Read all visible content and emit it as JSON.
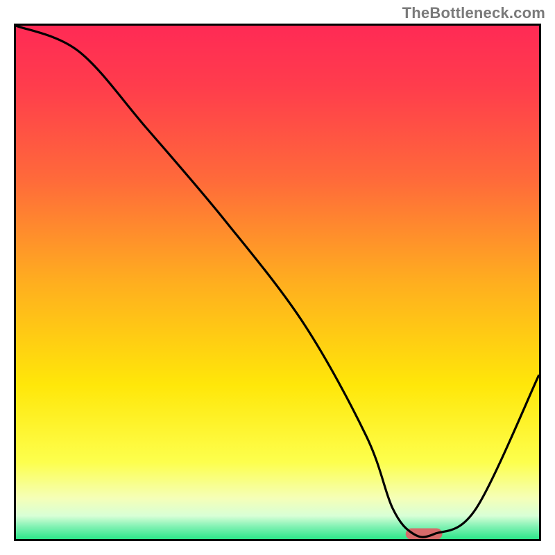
{
  "watermark": "TheBottleneck.com",
  "chart_data": {
    "type": "line",
    "title": "",
    "xlabel": "",
    "ylabel": "",
    "xlim": [
      0,
      100
    ],
    "ylim": [
      0,
      100
    ],
    "x": [
      0,
      12,
      25,
      40,
      55,
      67,
      72,
      76,
      80,
      88,
      100
    ],
    "values": [
      100,
      95,
      80,
      62,
      42,
      20,
      6,
      1,
      1,
      6,
      32
    ],
    "background_gradient": {
      "stops": [
        {
          "offset": 0.0,
          "color": "#ff2a55"
        },
        {
          "offset": 0.12,
          "color": "#ff3d4c"
        },
        {
          "offset": 0.3,
          "color": "#ff6a3a"
        },
        {
          "offset": 0.5,
          "color": "#ffae1f"
        },
        {
          "offset": 0.7,
          "color": "#ffe709"
        },
        {
          "offset": 0.85,
          "color": "#fdff4d"
        },
        {
          "offset": 0.92,
          "color": "#f5ffb7"
        },
        {
          "offset": 0.955,
          "color": "#d8ffd6"
        },
        {
          "offset": 0.975,
          "color": "#84f2b5"
        },
        {
          "offset": 1.0,
          "color": "#2de68a"
        }
      ]
    },
    "marker": {
      "x_center": 78,
      "y_center": 1,
      "color": "#d66a6a",
      "width": 7,
      "height": 2.2
    }
  }
}
